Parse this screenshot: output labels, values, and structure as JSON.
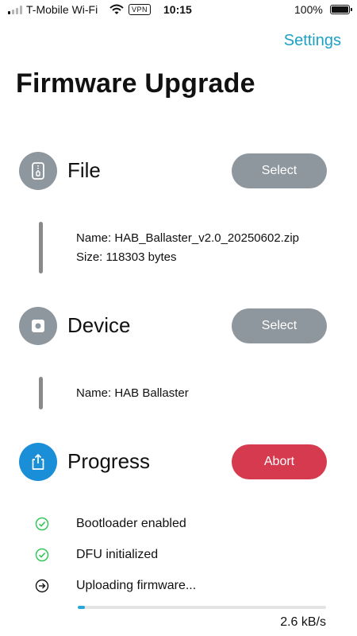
{
  "status_bar": {
    "carrier": "T-Mobile Wi-Fi",
    "vpn": "VPN",
    "time": "10:15",
    "battery": "100%"
  },
  "nav": {
    "settings_label": "Settings"
  },
  "page_title": "Firmware Upgrade",
  "file_section": {
    "title": "File",
    "button_label": "Select",
    "icon": "zip-file-icon",
    "name_line": "Name: HAB_Ballaster_v2.0_20250602.zip",
    "size_line": "Size: 118303 bytes"
  },
  "device_section": {
    "title": "Device",
    "button_label": "Select",
    "icon": "device-icon",
    "name_line": "Name: HAB Ballaster"
  },
  "progress_section": {
    "title": "Progress",
    "button_label": "Abort",
    "icon": "share-upload-icon",
    "steps": [
      {
        "label": "Bootloader enabled",
        "state": "done"
      },
      {
        "label": "DFU initialized",
        "state": "done"
      },
      {
        "label": "Uploading firmware...",
        "state": "in-progress"
      }
    ],
    "upload_progress": 0.03,
    "speed": "2.6 kB/s"
  },
  "colors": {
    "accent": "#1da1c4",
    "gray": "#8e979e",
    "progress_blue": "#1a8fd7",
    "abort_red": "#d63a4f",
    "check_green": "#34c759"
  }
}
